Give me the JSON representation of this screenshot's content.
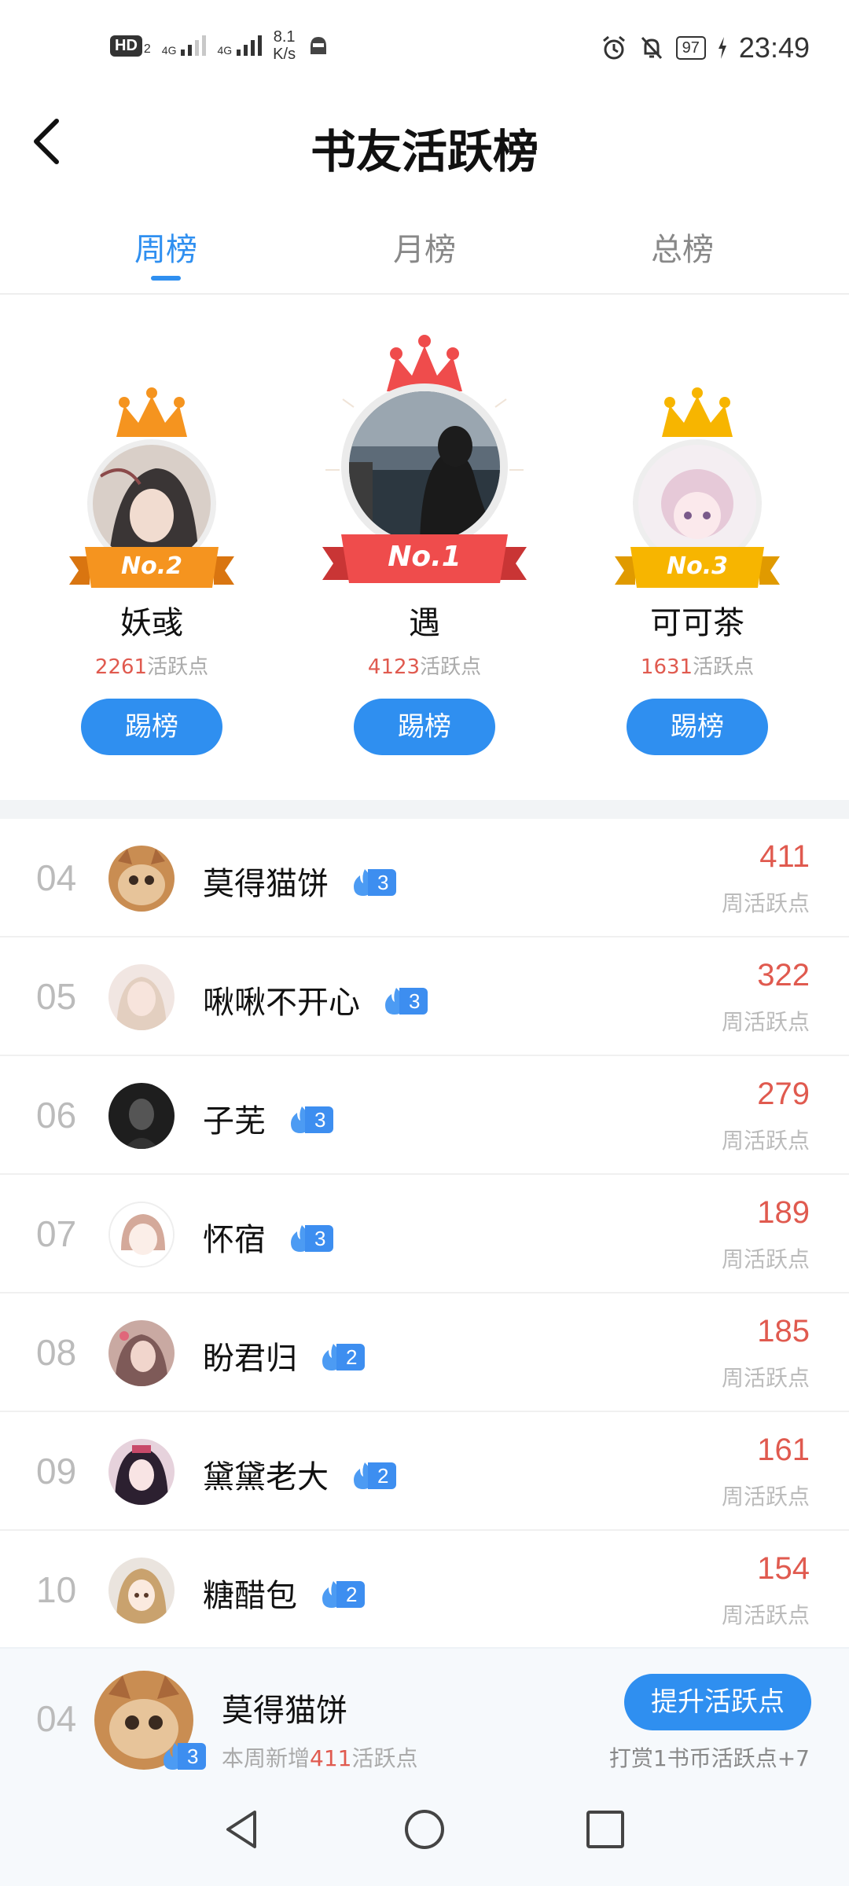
{
  "status_bar": {
    "hd_label": "HD",
    "hd_sub": "2",
    "net1": "4G",
    "net2": "4G",
    "speed_value": "8.1",
    "speed_unit": "K/s",
    "battery": "97",
    "time": "23:49"
  },
  "header": {
    "title": "书友活跃榜"
  },
  "tabs": [
    {
      "label": "周榜",
      "active": true
    },
    {
      "label": "月榜",
      "active": false
    },
    {
      "label": "总榜",
      "active": false
    }
  ],
  "podium": [
    {
      "rank_label": "No.2",
      "name": "妖彧",
      "score": "2261",
      "unit": "活跃点",
      "button": "踢榜",
      "crown_color": "#f5941f"
    },
    {
      "rank_label": "No.1",
      "name": "遇",
      "score": "4123",
      "unit": "活跃点",
      "button": "踢榜",
      "crown_color": "#ef4c4c"
    },
    {
      "rank_label": "No.3",
      "name": "可可茶",
      "score": "1631",
      "unit": "活跃点",
      "button": "踢榜",
      "crown_color": "#f7b500"
    }
  ],
  "ranking": [
    {
      "rank": "04",
      "name": "莫得猫饼",
      "level": "3",
      "score": "411",
      "unit": "周活跃点"
    },
    {
      "rank": "05",
      "name": "啾啾不开心",
      "level": "3",
      "score": "322",
      "unit": "周活跃点"
    },
    {
      "rank": "06",
      "name": "子芜",
      "level": "3",
      "score": "279",
      "unit": "周活跃点"
    },
    {
      "rank": "07",
      "name": "怀宿",
      "level": "3",
      "score": "189",
      "unit": "周活跃点"
    },
    {
      "rank": "08",
      "name": "盼君归",
      "level": "2",
      "score": "185",
      "unit": "周活跃点"
    },
    {
      "rank": "09",
      "name": "黛黛老大",
      "level": "2",
      "score": "161",
      "unit": "周活跃点"
    },
    {
      "rank": "10",
      "name": "糖醋包",
      "level": "2",
      "score": "154",
      "unit": "周活跃点"
    }
  ],
  "my_rank": {
    "rank": "04",
    "name": "莫得猫饼",
    "level": "3",
    "sub_prefix": "本周新增",
    "sub_value": "411",
    "sub_suffix": "活跃点",
    "button": "提升活跃点",
    "tip": "打赏1书币活跃点+7"
  },
  "colors": {
    "accent": "#2f8ff0",
    "score": "#e05a4f"
  },
  "icons": {
    "back": "back-arrow-icon",
    "fire": "flame-icon",
    "nav_back": "triangle-back-icon",
    "nav_home": "circle-home-icon",
    "nav_recent": "square-recent-icon"
  }
}
